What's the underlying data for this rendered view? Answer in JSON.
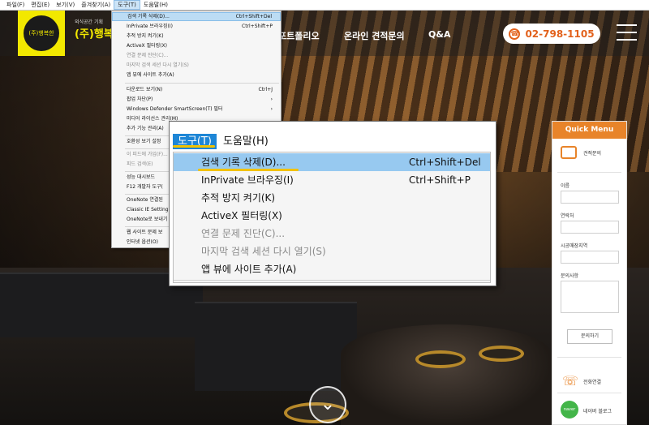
{
  "menubar": {
    "items": [
      "파일(F)",
      "편집(E)",
      "보기(V)",
      "즐겨찾기(A)",
      "도구(T)",
      "도움말(H)"
    ]
  },
  "site": {
    "logo_badge": "(주)행복한",
    "logo_sub": "외식공간 기획",
    "logo_main": "(주)행복한",
    "nav": [
      "포트폴리오",
      "온라인 견적문의",
      "Q&A"
    ],
    "phone": "02-798-1105"
  },
  "small_menu": {
    "items": [
      {
        "label": "검색 기록 삭제(D)...",
        "shortcut": "Ctrl+Shift+Del",
        "highlight": true
      },
      {
        "label": "InPrivate 브라우징(I)",
        "shortcut": "Ctrl+Shift+P"
      },
      {
        "label": "추적 방지 켜기(K)",
        "shortcut": ""
      },
      {
        "label": "ActiveX 필터링(X)",
        "shortcut": ""
      },
      {
        "label": "연결 문제 진단(C)...",
        "shortcut": "",
        "disabled": true
      },
      {
        "label": "마지막 검색 세션 다시 열기(S)",
        "shortcut": "",
        "disabled": true
      },
      {
        "label": "앱 뷰에 사이트 추가(A)",
        "shortcut": ""
      },
      {
        "label": "다운로드 보기(N)",
        "shortcut": "Ctrl+J"
      },
      {
        "label": "팝업 차단(P)",
        "shortcut": "›"
      },
      {
        "label": "Windows Defender SmartScreen(T) 필터",
        "shortcut": "›"
      },
      {
        "label": "미디어 라이선스 관리(M)",
        "shortcut": ""
      },
      {
        "label": "추가 기능 관리(A)",
        "shortcut": ""
      },
      {
        "label": "호환성 보기 설정",
        "shortcut": ""
      },
      {
        "label": "이 피드에 가입(F)...",
        "shortcut": "",
        "disabled": true
      },
      {
        "label": "피드 검색(E)",
        "shortcut": "",
        "disabled": true
      },
      {
        "label": "성능 대시보드",
        "shortcut": ""
      },
      {
        "label": "F12 개발자 도구(",
        "shortcut": ""
      },
      {
        "label": "OneNote 연결된",
        "shortcut": ""
      },
      {
        "label": "Classic IE Setting",
        "shortcut": ""
      },
      {
        "label": "OneNote로 보내기",
        "shortcut": ""
      },
      {
        "label": "웹 사이트 문제 보",
        "shortcut": ""
      },
      {
        "label": "인터넷 옵션(O)",
        "shortcut": ""
      }
    ]
  },
  "zoom": {
    "menubar": [
      "도구(T)",
      "도움말(H)"
    ],
    "items": [
      {
        "label": "검색 기록 삭제(D)...",
        "shortcut": "Ctrl+Shift+Del"
      },
      {
        "label": "InPrivate 브라우징(I)",
        "shortcut": "Ctrl+Shift+P"
      },
      {
        "label": "추적 방지 켜기(K)",
        "shortcut": ""
      },
      {
        "label": "ActiveX 필터링(X)",
        "shortcut": ""
      },
      {
        "label": "연결 문제 진단(C)...",
        "shortcut": ""
      },
      {
        "label": "마지막 검색 세션 다시 열기(S)",
        "shortcut": ""
      },
      {
        "label": "앱 뷰에 사이트 추가(A)",
        "shortcut": ""
      }
    ]
  },
  "quick_menu": {
    "title": "Quick Menu",
    "estimate_label": "견적문의",
    "fields": [
      "이름",
      "연락처",
      "시공매장지역",
      "문의사항"
    ],
    "submit": "문의하기",
    "call": "전화연결",
    "blog": "네이버 블로그",
    "blog_badge": "naver blog"
  },
  "colors": {
    "accent_orange": "#e8842a",
    "logo_yellow": "#f2e800",
    "menu_blue": "#1e86d6",
    "annotation_yellow": "#f2c200"
  }
}
